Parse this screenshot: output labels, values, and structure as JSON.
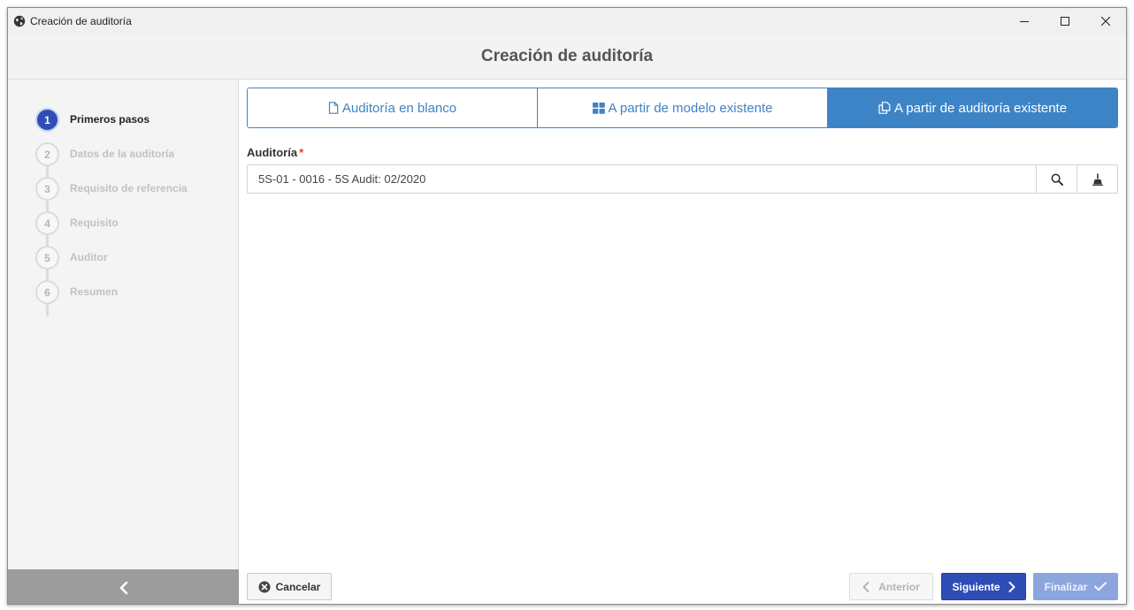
{
  "window": {
    "title": "Creación de auditoría",
    "controls": [
      "minimize",
      "maximize",
      "close"
    ]
  },
  "header": {
    "title": "Creación de auditoría"
  },
  "sidebar": {
    "steps": [
      {
        "number": "1",
        "label": "Primeros pasos",
        "active": true
      },
      {
        "number": "2",
        "label": "Datos de la auditoría",
        "active": false
      },
      {
        "number": "3",
        "label": "Requisito de referencia",
        "active": false
      },
      {
        "number": "4",
        "label": "Requisito",
        "active": false
      },
      {
        "number": "5",
        "label": "Auditor",
        "active": false
      },
      {
        "number": "6",
        "label": "Resumen",
        "active": false
      }
    ],
    "collapse_icon": "chevron-left-icon"
  },
  "tabs": [
    {
      "label": "Auditoría en blanco",
      "icon": "blank-document-icon",
      "selected": false
    },
    {
      "label": "A partir de modelo existente",
      "icon": "grid-icon",
      "selected": false
    },
    {
      "label": "A partir de auditoría existente",
      "icon": "copy-icon",
      "selected": true
    }
  ],
  "form": {
    "audit_label": "Auditoría",
    "required_marker": "*",
    "audit_value": "5S-01 - 0016 - 5S Audit: 02/2020",
    "search_icon": "search-icon",
    "clear_icon": "broom-icon"
  },
  "footer": {
    "cancel_label": "Cancelar",
    "previous_label": "Anterior",
    "next_label": "Siguiente",
    "finish_label": "Finalizar"
  },
  "colors": {
    "primary": "#2f4db6",
    "tab_accent": "#3d84c6",
    "finish_disabled": "#8ca6dd",
    "required": "#e53935"
  }
}
